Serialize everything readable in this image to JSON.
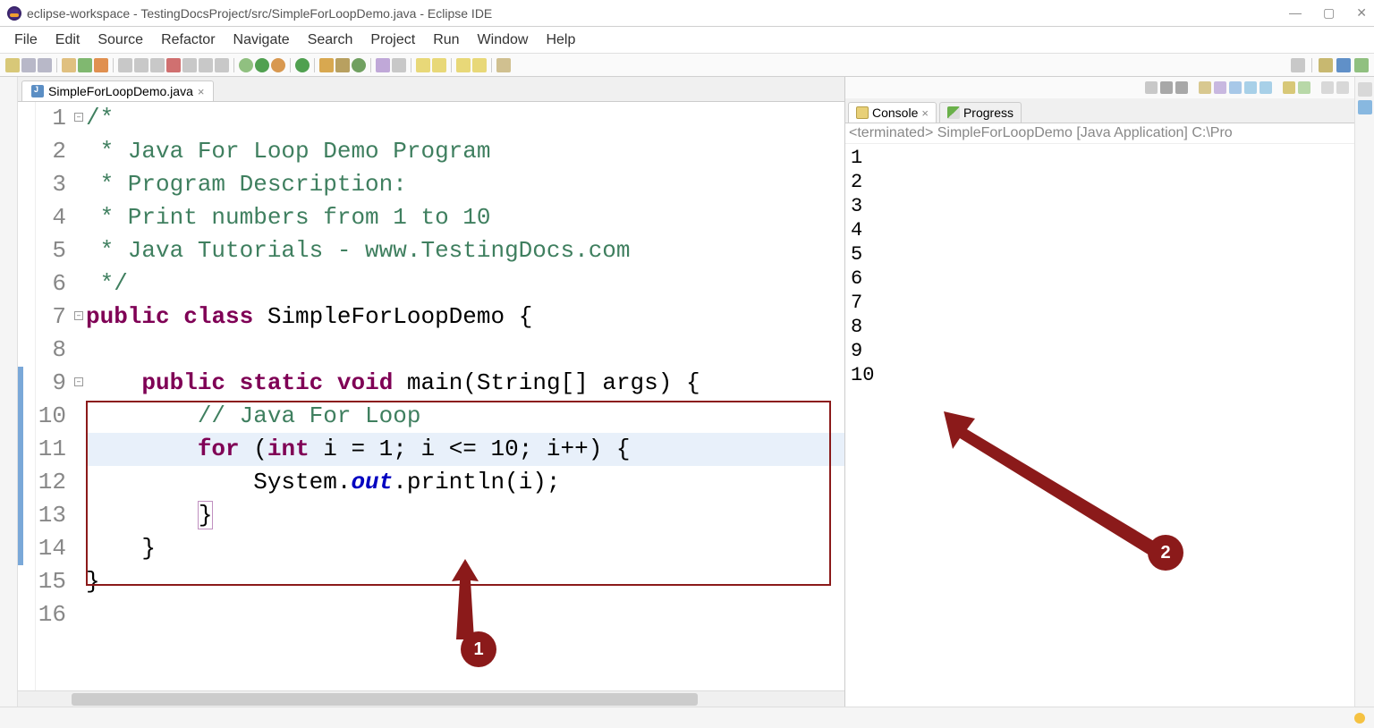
{
  "window": {
    "title": "eclipse-workspace - TestingDocsProject/src/SimpleForLoopDemo.java - Eclipse IDE"
  },
  "menu": [
    "File",
    "Edit",
    "Source",
    "Refactor",
    "Navigate",
    "Search",
    "Project",
    "Run",
    "Window",
    "Help"
  ],
  "editor": {
    "tab_label": "SimpleForLoopDemo.java",
    "lines": [
      {
        "n": 1,
        "tokens": [
          [
            "comment",
            "/*"
          ]
        ]
      },
      {
        "n": 2,
        "tokens": [
          [
            "comment",
            " * Java For Loop Demo Program"
          ]
        ]
      },
      {
        "n": 3,
        "tokens": [
          [
            "comment",
            " * Program Description:"
          ]
        ]
      },
      {
        "n": 4,
        "tokens": [
          [
            "comment",
            " * Print numbers from 1 to 10"
          ]
        ]
      },
      {
        "n": 5,
        "tokens": [
          [
            "comment",
            " * Java Tutorials - www.TestingDocs.com"
          ]
        ]
      },
      {
        "n": 6,
        "tokens": [
          [
            "comment",
            " */"
          ]
        ]
      },
      {
        "n": 7,
        "tokens": [
          [
            "keyword",
            "public"
          ],
          [
            "default",
            " "
          ],
          [
            "keyword",
            "class"
          ],
          [
            "default",
            " SimpleForLoopDemo {"
          ]
        ]
      },
      {
        "n": 8,
        "tokens": []
      },
      {
        "n": 9,
        "tokens": [
          [
            "default",
            "    "
          ],
          [
            "keyword",
            "public"
          ],
          [
            "default",
            " "
          ],
          [
            "keyword",
            "static"
          ],
          [
            "default",
            " "
          ],
          [
            "keyword",
            "void"
          ],
          [
            "default",
            " main(String[] args) {"
          ]
        ]
      },
      {
        "n": 10,
        "tokens": [
          [
            "default",
            "        "
          ],
          [
            "comment",
            "// Java For Loop"
          ]
        ]
      },
      {
        "n": 11,
        "hl": true,
        "tokens": [
          [
            "default",
            "        "
          ],
          [
            "keyword",
            "for"
          ],
          [
            "default",
            " ("
          ],
          [
            "keyword",
            "int"
          ],
          [
            "default",
            " i = 1; i <= 10; i++) {"
          ]
        ]
      },
      {
        "n": 12,
        "tokens": [
          [
            "default",
            "            System."
          ],
          [
            "static",
            "out"
          ],
          [
            "default",
            ".println(i);"
          ]
        ]
      },
      {
        "n": 13,
        "tokens": [
          [
            "default",
            "        "
          ],
          [
            "bracket",
            "}"
          ]
        ]
      },
      {
        "n": 14,
        "tokens": [
          [
            "default",
            "    }"
          ]
        ]
      },
      {
        "n": 15,
        "tokens": [
          [
            "default",
            "}"
          ]
        ]
      },
      {
        "n": 16,
        "tokens": []
      }
    ],
    "blue_markers": [
      {
        "from": 9,
        "to": 14
      }
    ]
  },
  "console": {
    "tab_label": "Console",
    "progress_tab_label": "Progress",
    "status": "<terminated> SimpleForLoopDemo [Java Application] C:\\Pro",
    "output": [
      "1",
      "2",
      "3",
      "4",
      "5",
      "6",
      "7",
      "8",
      "9",
      "10"
    ]
  },
  "annotations": {
    "one": "1",
    "two": "2"
  }
}
